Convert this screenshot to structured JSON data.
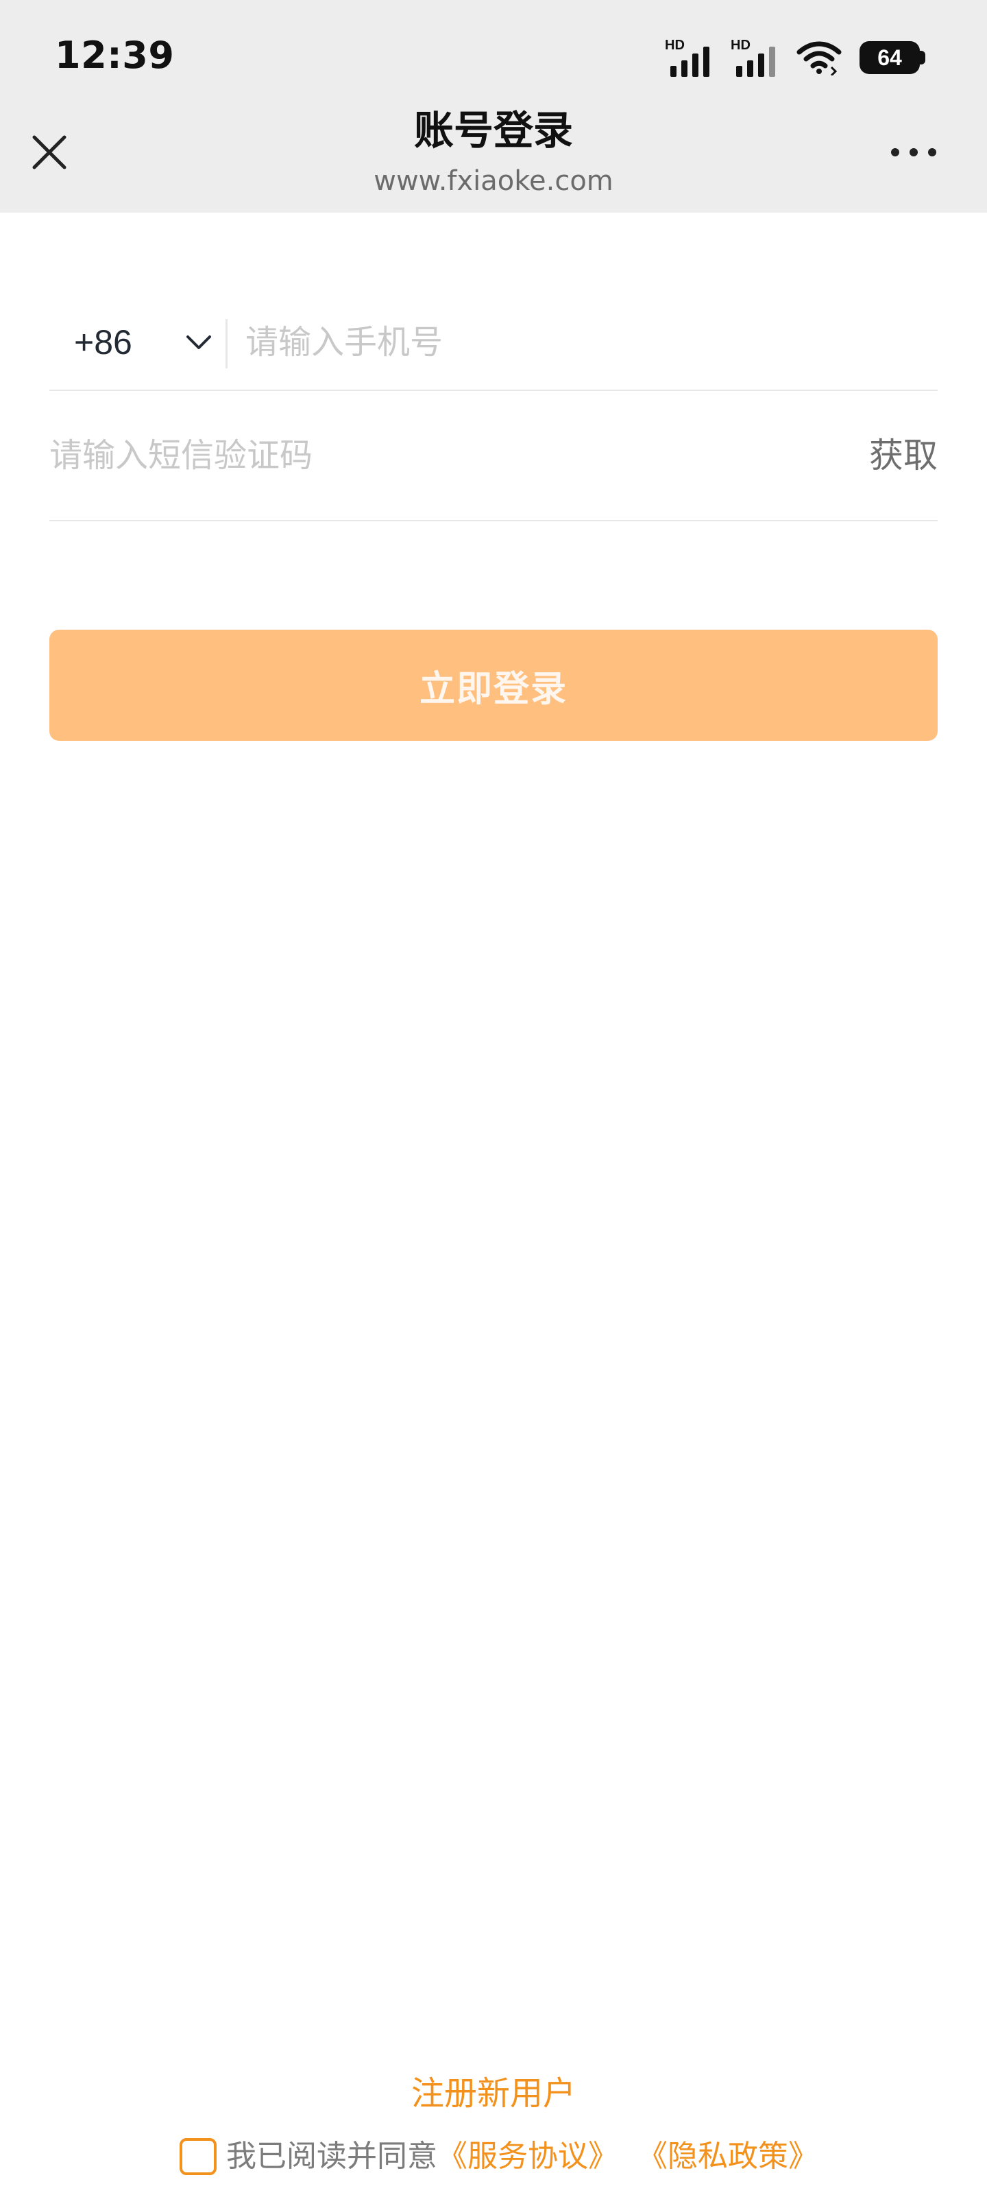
{
  "status_bar": {
    "time": "12:39",
    "signal_badges": [
      "HD",
      "HD"
    ],
    "battery_level": "64",
    "icons": [
      "signal-icon",
      "signal-icon",
      "wifi-icon",
      "battery-icon"
    ]
  },
  "header": {
    "title": "账号登录",
    "url": "www.fxiaoke.com",
    "close_icon": "close-icon",
    "more_icon": "more-icon"
  },
  "login_form": {
    "country_code": "+86",
    "phone_placeholder": "请输入手机号",
    "sms_placeholder": "请输入短信验证码",
    "get_code_label": "获取",
    "login_button_label": "立即登录"
  },
  "footer": {
    "register_label": "注册新用户",
    "agreement_prefix": "我已阅读并同意",
    "service_agreement": "《服务协议》",
    "privacy_policy": "《隐私政策》"
  },
  "colors": {
    "header_background": "#ededed",
    "accent": "#f3911d",
    "login_button_disabled": "#ffbf7f",
    "placeholder": "#c8c8c8",
    "divider": "#e8e8e8"
  }
}
